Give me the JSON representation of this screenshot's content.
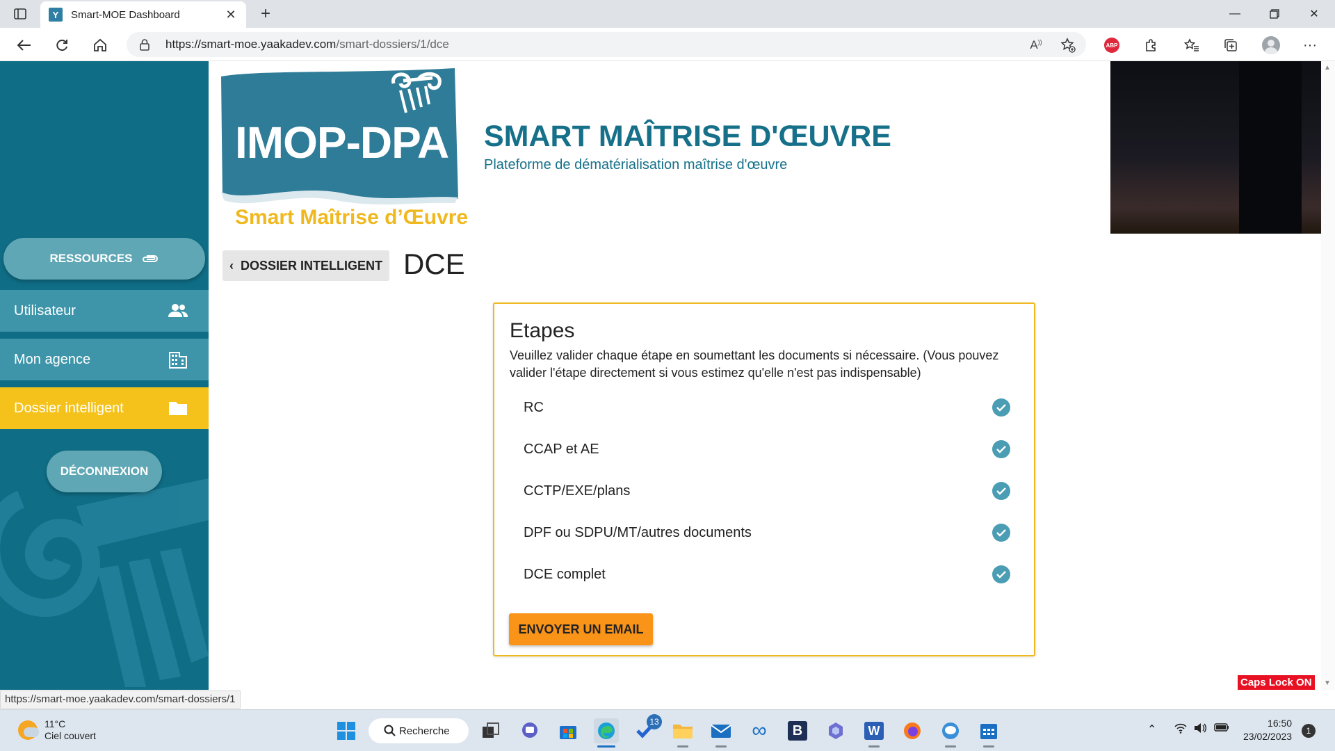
{
  "browser": {
    "tab_title": "Smart-MOE Dashboard",
    "tab_favicon_letter": "Y",
    "url_host": "https://smart-moe.yaakadev.com",
    "url_path": "/smart-dossiers/1/dce",
    "status_url": "https://smart-moe.yaakadev.com/smart-dossiers/1",
    "icons": [
      "sidebar-toggle-icon",
      "close-icon",
      "new-tab-icon",
      "minimize-icon",
      "restore-icon",
      "window-close-icon",
      "back-icon",
      "reload-icon",
      "home-icon",
      "lock-icon",
      "read-aloud-icon",
      "add-favorite-icon",
      "adblock-icon",
      "extensions-icon",
      "favorites-icon",
      "collections-icon",
      "profile-icon",
      "more-icon"
    ],
    "abp_label": "ABP"
  },
  "sidebar": {
    "resources_label": "RESSOURCES",
    "items": [
      {
        "label": "Utilisateur",
        "icon": "users-icon"
      },
      {
        "label": "Mon agence",
        "icon": "building-icon"
      },
      {
        "label": "Dossier intelligent",
        "icon": "folder-icon"
      }
    ],
    "logout_label": "DÉCONNEXION",
    "accent_color": "#0f6e86",
    "active_color": "#f4c21a"
  },
  "header": {
    "logo_text": "IMOP-DPA",
    "logo_subtitle": "Smart Maîtrise d’Œuvre",
    "title": "SMART MAÎTRISE D'ŒUVRE",
    "subtitle": "Plateforme de dématérialisation maîtrise d'œuvre"
  },
  "main": {
    "back_label": "DOSSIER INTELLIGENT",
    "page_title": "DCE",
    "card": {
      "title": "Etapes",
      "description": "Veuillez valider chaque étape en soumettant les documents si nécessaire. (Vous pouvez valider l'étape directement si vous estimez qu'elle n'est pas indispensable)",
      "steps": [
        {
          "label": "RC",
          "done": true
        },
        {
          "label": "CCAP et AE",
          "done": true
        },
        {
          "label": "CCTP/EXE/plans",
          "done": true
        },
        {
          "label": "DPF ou SDPU/MT/autres documents",
          "done": true
        },
        {
          "label": "DCE complet",
          "done": true
        }
      ],
      "email_button": "ENVOYER UN EMAIL"
    },
    "caps_lock": "Caps Lock ON"
  },
  "taskbar": {
    "weather_temp": "11°C",
    "weather_desc": "Ciel couvert",
    "search_label": "Recherche",
    "todo_badge": "13",
    "time": "16:50",
    "date": "23/02/2023",
    "notifications": "1"
  }
}
